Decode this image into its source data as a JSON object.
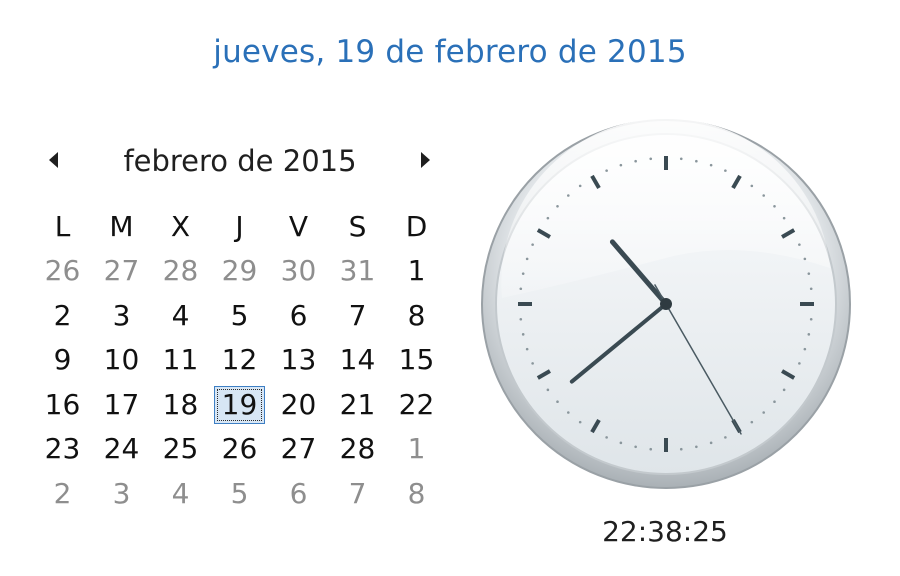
{
  "header": {
    "date_text": "jueves, 19 de febrero de 2015"
  },
  "calendar": {
    "month_title": "febrero de 2015",
    "prev_icon": "triangle-left-icon",
    "next_icon": "triangle-right-icon",
    "weekdays": [
      "L",
      "M",
      "X",
      "J",
      "V",
      "S",
      "D"
    ],
    "weeks": [
      [
        {
          "d": "26",
          "other": true
        },
        {
          "d": "27",
          "other": true
        },
        {
          "d": "28",
          "other": true
        },
        {
          "d": "29",
          "other": true
        },
        {
          "d": "30",
          "other": true
        },
        {
          "d": "31",
          "other": true
        },
        {
          "d": "1",
          "other": false
        }
      ],
      [
        {
          "d": "2",
          "other": false
        },
        {
          "d": "3",
          "other": false
        },
        {
          "d": "4",
          "other": false
        },
        {
          "d": "5",
          "other": false
        },
        {
          "d": "6",
          "other": false
        },
        {
          "d": "7",
          "other": false
        },
        {
          "d": "8",
          "other": false
        }
      ],
      [
        {
          "d": "9",
          "other": false
        },
        {
          "d": "10",
          "other": false
        },
        {
          "d": "11",
          "other": false
        },
        {
          "d": "12",
          "other": false
        },
        {
          "d": "13",
          "other": false
        },
        {
          "d": "14",
          "other": false
        },
        {
          "d": "15",
          "other": false
        }
      ],
      [
        {
          "d": "16",
          "other": false
        },
        {
          "d": "17",
          "other": false
        },
        {
          "d": "18",
          "other": false
        },
        {
          "d": "19",
          "other": false,
          "today": true
        },
        {
          "d": "20",
          "other": false
        },
        {
          "d": "21",
          "other": false
        },
        {
          "d": "22",
          "other": false
        }
      ],
      [
        {
          "d": "23",
          "other": false
        },
        {
          "d": "24",
          "other": false
        },
        {
          "d": "25",
          "other": false
        },
        {
          "d": "26",
          "other": false
        },
        {
          "d": "27",
          "other": false
        },
        {
          "d": "28",
          "other": false
        },
        {
          "d": "1",
          "other": true
        }
      ],
      [
        {
          "d": "2",
          "other": true
        },
        {
          "d": "3",
          "other": true
        },
        {
          "d": "4",
          "other": true
        },
        {
          "d": "5",
          "other": true
        },
        {
          "d": "6",
          "other": true
        },
        {
          "d": "7",
          "other": true
        },
        {
          "d": "8",
          "other": true
        }
      ]
    ]
  },
  "clock": {
    "icon": "analog-clock-icon",
    "time_text": "22:38:25",
    "hours": 22,
    "minutes": 38,
    "seconds": 25,
    "face_color": "#f2f5f7",
    "hand_color": "#3a4a52"
  },
  "colors": {
    "accent": "#2a70b8",
    "other_month_day": "#8e8e8e",
    "today_fill": "#d7e6f5"
  }
}
